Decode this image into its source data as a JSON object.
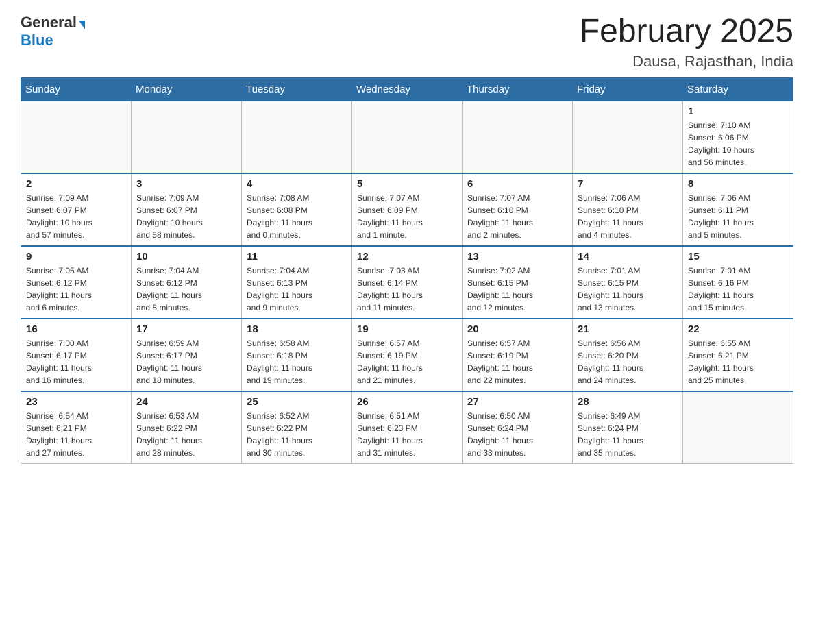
{
  "header": {
    "logo_general": "General",
    "logo_blue": "Blue",
    "title": "February 2025",
    "subtitle": "Dausa, Rajasthan, India"
  },
  "weekdays": [
    "Sunday",
    "Monday",
    "Tuesday",
    "Wednesday",
    "Thursday",
    "Friday",
    "Saturday"
  ],
  "weeks": [
    [
      {
        "day": "",
        "info": ""
      },
      {
        "day": "",
        "info": ""
      },
      {
        "day": "",
        "info": ""
      },
      {
        "day": "",
        "info": ""
      },
      {
        "day": "",
        "info": ""
      },
      {
        "day": "",
        "info": ""
      },
      {
        "day": "1",
        "info": "Sunrise: 7:10 AM\nSunset: 6:06 PM\nDaylight: 10 hours\nand 56 minutes."
      }
    ],
    [
      {
        "day": "2",
        "info": "Sunrise: 7:09 AM\nSunset: 6:07 PM\nDaylight: 10 hours\nand 57 minutes."
      },
      {
        "day": "3",
        "info": "Sunrise: 7:09 AM\nSunset: 6:07 PM\nDaylight: 10 hours\nand 58 minutes."
      },
      {
        "day": "4",
        "info": "Sunrise: 7:08 AM\nSunset: 6:08 PM\nDaylight: 11 hours\nand 0 minutes."
      },
      {
        "day": "5",
        "info": "Sunrise: 7:07 AM\nSunset: 6:09 PM\nDaylight: 11 hours\nand 1 minute."
      },
      {
        "day": "6",
        "info": "Sunrise: 7:07 AM\nSunset: 6:10 PM\nDaylight: 11 hours\nand 2 minutes."
      },
      {
        "day": "7",
        "info": "Sunrise: 7:06 AM\nSunset: 6:10 PM\nDaylight: 11 hours\nand 4 minutes."
      },
      {
        "day": "8",
        "info": "Sunrise: 7:06 AM\nSunset: 6:11 PM\nDaylight: 11 hours\nand 5 minutes."
      }
    ],
    [
      {
        "day": "9",
        "info": "Sunrise: 7:05 AM\nSunset: 6:12 PM\nDaylight: 11 hours\nand 6 minutes."
      },
      {
        "day": "10",
        "info": "Sunrise: 7:04 AM\nSunset: 6:12 PM\nDaylight: 11 hours\nand 8 minutes."
      },
      {
        "day": "11",
        "info": "Sunrise: 7:04 AM\nSunset: 6:13 PM\nDaylight: 11 hours\nand 9 minutes."
      },
      {
        "day": "12",
        "info": "Sunrise: 7:03 AM\nSunset: 6:14 PM\nDaylight: 11 hours\nand 11 minutes."
      },
      {
        "day": "13",
        "info": "Sunrise: 7:02 AM\nSunset: 6:15 PM\nDaylight: 11 hours\nand 12 minutes."
      },
      {
        "day": "14",
        "info": "Sunrise: 7:01 AM\nSunset: 6:15 PM\nDaylight: 11 hours\nand 13 minutes."
      },
      {
        "day": "15",
        "info": "Sunrise: 7:01 AM\nSunset: 6:16 PM\nDaylight: 11 hours\nand 15 minutes."
      }
    ],
    [
      {
        "day": "16",
        "info": "Sunrise: 7:00 AM\nSunset: 6:17 PM\nDaylight: 11 hours\nand 16 minutes."
      },
      {
        "day": "17",
        "info": "Sunrise: 6:59 AM\nSunset: 6:17 PM\nDaylight: 11 hours\nand 18 minutes."
      },
      {
        "day": "18",
        "info": "Sunrise: 6:58 AM\nSunset: 6:18 PM\nDaylight: 11 hours\nand 19 minutes."
      },
      {
        "day": "19",
        "info": "Sunrise: 6:57 AM\nSunset: 6:19 PM\nDaylight: 11 hours\nand 21 minutes."
      },
      {
        "day": "20",
        "info": "Sunrise: 6:57 AM\nSunset: 6:19 PM\nDaylight: 11 hours\nand 22 minutes."
      },
      {
        "day": "21",
        "info": "Sunrise: 6:56 AM\nSunset: 6:20 PM\nDaylight: 11 hours\nand 24 minutes."
      },
      {
        "day": "22",
        "info": "Sunrise: 6:55 AM\nSunset: 6:21 PM\nDaylight: 11 hours\nand 25 minutes."
      }
    ],
    [
      {
        "day": "23",
        "info": "Sunrise: 6:54 AM\nSunset: 6:21 PM\nDaylight: 11 hours\nand 27 minutes."
      },
      {
        "day": "24",
        "info": "Sunrise: 6:53 AM\nSunset: 6:22 PM\nDaylight: 11 hours\nand 28 minutes."
      },
      {
        "day": "25",
        "info": "Sunrise: 6:52 AM\nSunset: 6:22 PM\nDaylight: 11 hours\nand 30 minutes."
      },
      {
        "day": "26",
        "info": "Sunrise: 6:51 AM\nSunset: 6:23 PM\nDaylight: 11 hours\nand 31 minutes."
      },
      {
        "day": "27",
        "info": "Sunrise: 6:50 AM\nSunset: 6:24 PM\nDaylight: 11 hours\nand 33 minutes."
      },
      {
        "day": "28",
        "info": "Sunrise: 6:49 AM\nSunset: 6:24 PM\nDaylight: 11 hours\nand 35 minutes."
      },
      {
        "day": "",
        "info": ""
      }
    ]
  ]
}
